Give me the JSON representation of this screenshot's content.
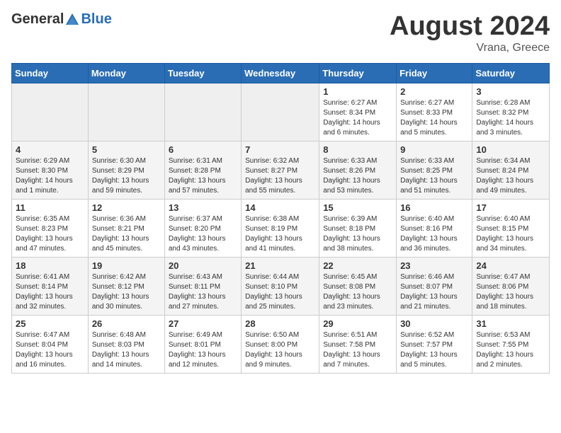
{
  "header": {
    "logo_general": "General",
    "logo_blue": "Blue",
    "month_title": "August 2024",
    "location": "Vrana, Greece"
  },
  "days_of_week": [
    "Sunday",
    "Monday",
    "Tuesday",
    "Wednesday",
    "Thursday",
    "Friday",
    "Saturday"
  ],
  "weeks": [
    [
      {
        "day": "",
        "info": ""
      },
      {
        "day": "",
        "info": ""
      },
      {
        "day": "",
        "info": ""
      },
      {
        "day": "",
        "info": ""
      },
      {
        "day": "1",
        "info": "Sunrise: 6:27 AM\nSunset: 8:34 PM\nDaylight: 14 hours and 6 minutes."
      },
      {
        "day": "2",
        "info": "Sunrise: 6:27 AM\nSunset: 8:33 PM\nDaylight: 14 hours and 5 minutes."
      },
      {
        "day": "3",
        "info": "Sunrise: 6:28 AM\nSunset: 8:32 PM\nDaylight: 14 hours and 3 minutes."
      }
    ],
    [
      {
        "day": "4",
        "info": "Sunrise: 6:29 AM\nSunset: 8:30 PM\nDaylight: 14 hours and 1 minute."
      },
      {
        "day": "5",
        "info": "Sunrise: 6:30 AM\nSunset: 8:29 PM\nDaylight: 13 hours and 59 minutes."
      },
      {
        "day": "6",
        "info": "Sunrise: 6:31 AM\nSunset: 8:28 PM\nDaylight: 13 hours and 57 minutes."
      },
      {
        "day": "7",
        "info": "Sunrise: 6:32 AM\nSunset: 8:27 PM\nDaylight: 13 hours and 55 minutes."
      },
      {
        "day": "8",
        "info": "Sunrise: 6:33 AM\nSunset: 8:26 PM\nDaylight: 13 hours and 53 minutes."
      },
      {
        "day": "9",
        "info": "Sunrise: 6:33 AM\nSunset: 8:25 PM\nDaylight: 13 hours and 51 minutes."
      },
      {
        "day": "10",
        "info": "Sunrise: 6:34 AM\nSunset: 8:24 PM\nDaylight: 13 hours and 49 minutes."
      }
    ],
    [
      {
        "day": "11",
        "info": "Sunrise: 6:35 AM\nSunset: 8:23 PM\nDaylight: 13 hours and 47 minutes."
      },
      {
        "day": "12",
        "info": "Sunrise: 6:36 AM\nSunset: 8:21 PM\nDaylight: 13 hours and 45 minutes."
      },
      {
        "day": "13",
        "info": "Sunrise: 6:37 AM\nSunset: 8:20 PM\nDaylight: 13 hours and 43 minutes."
      },
      {
        "day": "14",
        "info": "Sunrise: 6:38 AM\nSunset: 8:19 PM\nDaylight: 13 hours and 41 minutes."
      },
      {
        "day": "15",
        "info": "Sunrise: 6:39 AM\nSunset: 8:18 PM\nDaylight: 13 hours and 38 minutes."
      },
      {
        "day": "16",
        "info": "Sunrise: 6:40 AM\nSunset: 8:16 PM\nDaylight: 13 hours and 36 minutes."
      },
      {
        "day": "17",
        "info": "Sunrise: 6:40 AM\nSunset: 8:15 PM\nDaylight: 13 hours and 34 minutes."
      }
    ],
    [
      {
        "day": "18",
        "info": "Sunrise: 6:41 AM\nSunset: 8:14 PM\nDaylight: 13 hours and 32 minutes."
      },
      {
        "day": "19",
        "info": "Sunrise: 6:42 AM\nSunset: 8:12 PM\nDaylight: 13 hours and 30 minutes."
      },
      {
        "day": "20",
        "info": "Sunrise: 6:43 AM\nSunset: 8:11 PM\nDaylight: 13 hours and 27 minutes."
      },
      {
        "day": "21",
        "info": "Sunrise: 6:44 AM\nSunset: 8:10 PM\nDaylight: 13 hours and 25 minutes."
      },
      {
        "day": "22",
        "info": "Sunrise: 6:45 AM\nSunset: 8:08 PM\nDaylight: 13 hours and 23 minutes."
      },
      {
        "day": "23",
        "info": "Sunrise: 6:46 AM\nSunset: 8:07 PM\nDaylight: 13 hours and 21 minutes."
      },
      {
        "day": "24",
        "info": "Sunrise: 6:47 AM\nSunset: 8:06 PM\nDaylight: 13 hours and 18 minutes."
      }
    ],
    [
      {
        "day": "25",
        "info": "Sunrise: 6:47 AM\nSunset: 8:04 PM\nDaylight: 13 hours and 16 minutes."
      },
      {
        "day": "26",
        "info": "Sunrise: 6:48 AM\nSunset: 8:03 PM\nDaylight: 13 hours and 14 minutes."
      },
      {
        "day": "27",
        "info": "Sunrise: 6:49 AM\nSunset: 8:01 PM\nDaylight: 13 hours and 12 minutes."
      },
      {
        "day": "28",
        "info": "Sunrise: 6:50 AM\nSunset: 8:00 PM\nDaylight: 13 hours and 9 minutes."
      },
      {
        "day": "29",
        "info": "Sunrise: 6:51 AM\nSunset: 7:58 PM\nDaylight: 13 hours and 7 minutes."
      },
      {
        "day": "30",
        "info": "Sunrise: 6:52 AM\nSunset: 7:57 PM\nDaylight: 13 hours and 5 minutes."
      },
      {
        "day": "31",
        "info": "Sunrise: 6:53 AM\nSunset: 7:55 PM\nDaylight: 13 hours and 2 minutes."
      }
    ]
  ]
}
